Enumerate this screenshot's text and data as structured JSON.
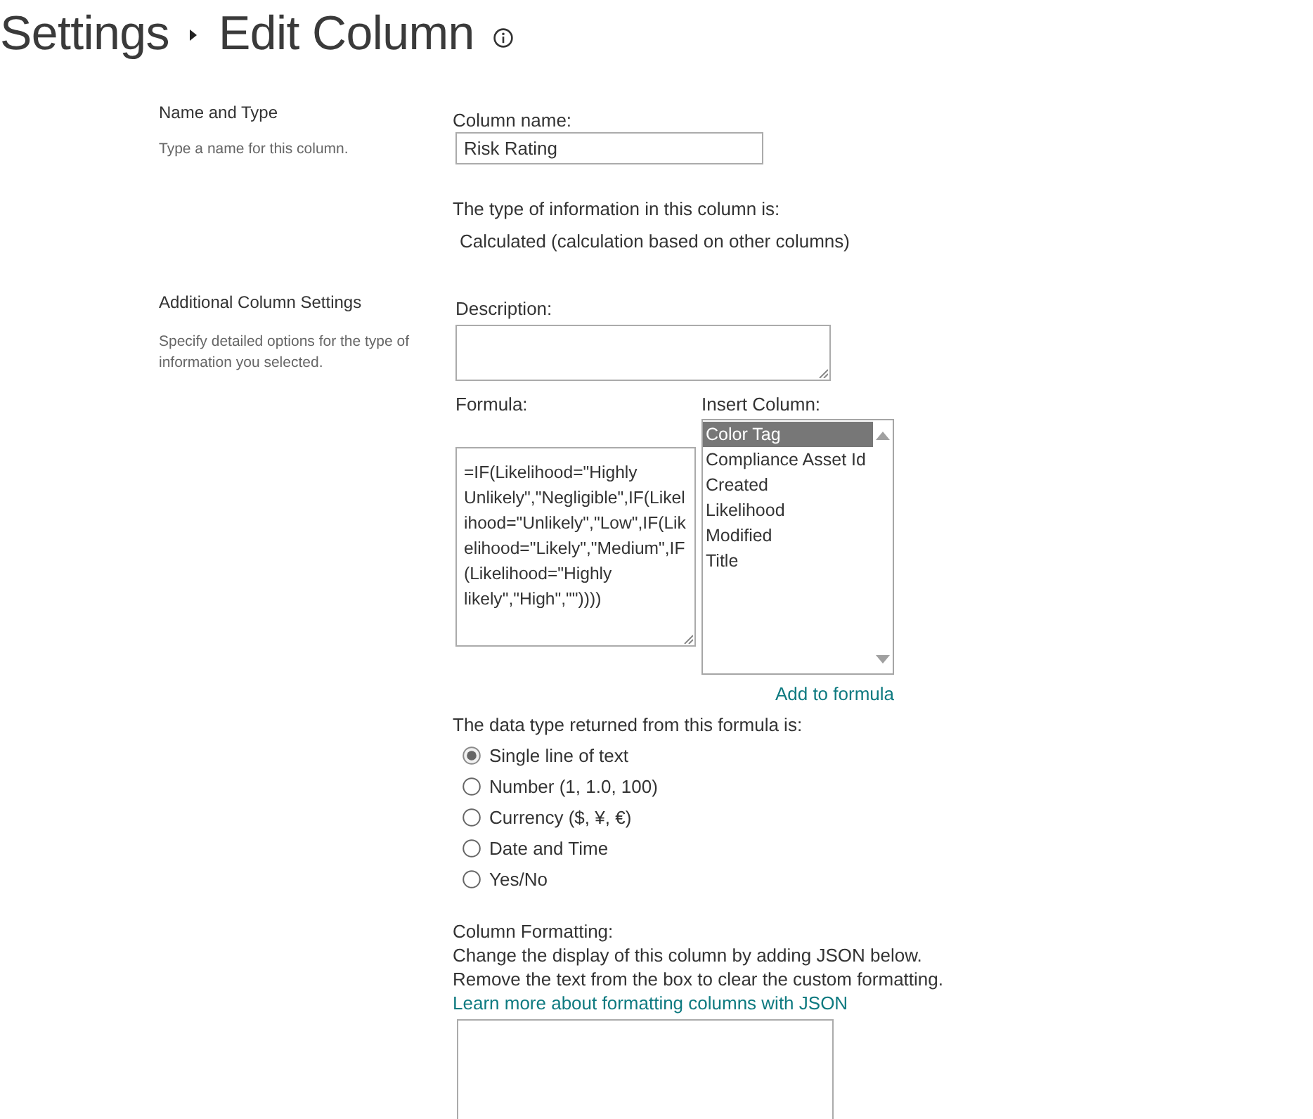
{
  "page_title": {
    "parent": "Settings",
    "current": "Edit Column"
  },
  "name_and_type": {
    "title": "Name and Type",
    "description": "Type a name for this column.",
    "column_name": {
      "label": "Column name:",
      "value": "Risk Rating"
    },
    "type_label": "The type of information in this column is:",
    "type_value": "Calculated (calculation based on other columns)"
  },
  "additional_settings": {
    "title": "Additional Column Settings",
    "description": "Specify detailed options for the type of information you selected.",
    "description_field": {
      "label": "Description:"
    },
    "formula": {
      "label": "Formula:",
      "value": "=IF(Likelihood=\"Highly Unlikely\",\"Negligible\",IF(Likelihood=\"Unlikely\",\"Low\",IF(Likelihood=\"Likely\",\"Medium\",IF(Likelihood=\"Highly likely\",\"High\",\"\"))))"
    },
    "insert_column": {
      "label": "Insert Column:",
      "items": [
        {
          "label": "Color Tag",
          "selected": true
        },
        {
          "label": "Compliance Asset Id",
          "selected": false
        },
        {
          "label": "Created",
          "selected": false
        },
        {
          "label": "Likelihood",
          "selected": false
        },
        {
          "label": "Modified",
          "selected": false
        },
        {
          "label": "Title",
          "selected": false
        }
      ],
      "link": "Add to formula"
    },
    "return_type": {
      "label": "The data type returned from this formula is:",
      "options": [
        {
          "label": "Single line of text",
          "selected": true
        },
        {
          "label": "Number (1, 1.0, 100)",
          "selected": false
        },
        {
          "label": "Currency ($, ¥, €)",
          "selected": false
        },
        {
          "label": "Date and Time",
          "selected": false
        },
        {
          "label": "Yes/No",
          "selected": false
        }
      ]
    },
    "column_formatting": {
      "label": "Column Formatting:",
      "lines": [
        "Change the display of this column by adding JSON below.",
        "Remove the text from the box to clear the custom formatting."
      ],
      "link": "Learn more about formatting columns with JSON"
    }
  }
}
